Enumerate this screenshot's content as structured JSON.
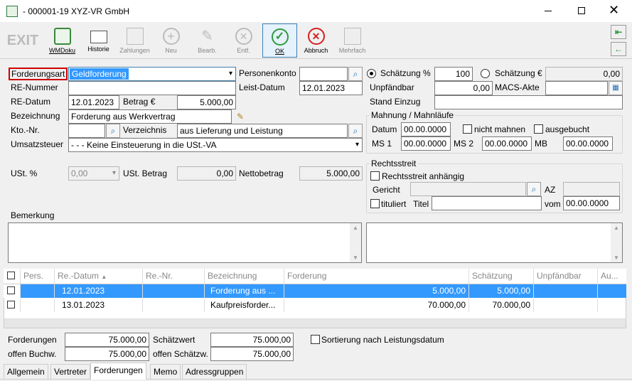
{
  "window": {
    "title": "- 000001-19 XYZ-VR GmbH"
  },
  "toolbar": {
    "exit": "EXIT",
    "wmdoku": "WMDoku",
    "historie": "Historie",
    "zahlungen": "Zahlungen",
    "neu": "Neu",
    "bearb": "Bearb.",
    "entf": "Entf.",
    "ok": "OK",
    "abbruch": "Abbruch",
    "mehrfach": "Mehrfach"
  },
  "form": {
    "forderungsart_label": "Forderungsart",
    "forderungsart_value": "Geldforderung",
    "renummer_label": "RE-Nummer",
    "renummer_value": "",
    "redatum_label": "RE-Datum",
    "redatum_value": "12.01.2023",
    "betrag_label": "Betrag €",
    "betrag_value": "5.000,00",
    "bezeichnung_label": "Bezeichnung",
    "bezeichnung_value": "Forderung aus Werkvertrag",
    "ktonr_label": "Kto.-Nr.",
    "ktonr_value": "",
    "verzeichnis_label": "Verzeichnis",
    "verzeichnis_value": "aus Lieferung und Leistung",
    "umsatzsteuer_label": "Umsatzsteuer",
    "umsatzsteuer_value": "- - - Keine Einsteuerung in die USt.-VA",
    "ust_label": "USt. %",
    "ust_value": "0,00",
    "ustbetrag_label": "USt. Betrag",
    "ustbetrag_value": "0,00",
    "netto_label": "Nettobetrag",
    "netto_value": "5.000,00",
    "personenkonto_label": "Personenkonto",
    "personenkonto_value": "",
    "leistdatum_label": "Leist-Datum",
    "leistdatum_value": "12.01.2023",
    "schaetzung_pct_label": "Schätzung %",
    "schaetzung_pct_value": "100",
    "schaetzung_eur_label": "Schätzung €",
    "schaetzung_eur_value": "0,00",
    "unpfaendbar_label": "Unpfändbar",
    "unpfaendbar_value": "0,00",
    "macs_label": "MACS-Akte",
    "macs_value": "",
    "stand_label": "Stand Einzug",
    "stand_value": "",
    "bemerkung_label": "Bemerkung"
  },
  "mahnung": {
    "title": "Mahnung / Mahnläufe",
    "datum_label": "Datum",
    "datum_value": "00.00.0000",
    "nicht_mahnen": "nicht mahnen",
    "ausgebucht": "ausgebucht",
    "ms1_label": "MS 1",
    "ms1_value": "00.00.0000",
    "ms2_label": "MS 2",
    "ms2_value": "00.00.0000",
    "mb_label": "MB",
    "mb_value": "00.00.0000"
  },
  "rechtsstreit": {
    "title": "Rechtsstreit",
    "anhaengig": "Rechtsstreit anhängig",
    "gericht_label": "Gericht",
    "gericht_value": "",
    "az_label": "AZ",
    "az_value": "",
    "tituliert": "tituliert",
    "titel_label": "Titel",
    "titel_value": "",
    "vom_label": "vom",
    "vom_value": "00.00.0000"
  },
  "grid": {
    "headers": [
      "Pers.",
      "Re.-Datum",
      "Re.-Nr.",
      "Bezeichnung",
      "Forderung",
      "Schätzung",
      "Unpfändbar",
      "Au..."
    ],
    "rows": [
      {
        "pers": "",
        "datum": "12.01.2023",
        "nr": "",
        "bez": "Forderung aus ...",
        "ford": "5.000,00",
        "schaetz": "5.000,00",
        "unpf": ""
      },
      {
        "pers": "",
        "datum": "13.01.2023",
        "nr": "",
        "bez": "Kaufpreisforder...",
        "ford": "70.000,00",
        "schaetz": "70.000,00",
        "unpf": ""
      }
    ]
  },
  "summary": {
    "forderungen_label": "Forderungen",
    "forderungen_value": "75.000,00",
    "schaetzwert_label": "Schätzwert",
    "schaetzwert_value": "75.000,00",
    "offenbuch_label": "offen Buchw.",
    "offenbuch_value": "75.000,00",
    "offenschaetz_label": "offen Schätzw.",
    "offenschaetz_value": "75.000,00",
    "sortierung": "Sortierung nach Leistungsdatum"
  },
  "tabs": [
    "Allgemein",
    "Vertreter",
    "Forderungen",
    "Memo",
    "Adressgruppen"
  ],
  "colors": {
    "selection": "#3399ff",
    "highlight_border": "#cc0000",
    "ok_border": "#3c7fb1"
  }
}
